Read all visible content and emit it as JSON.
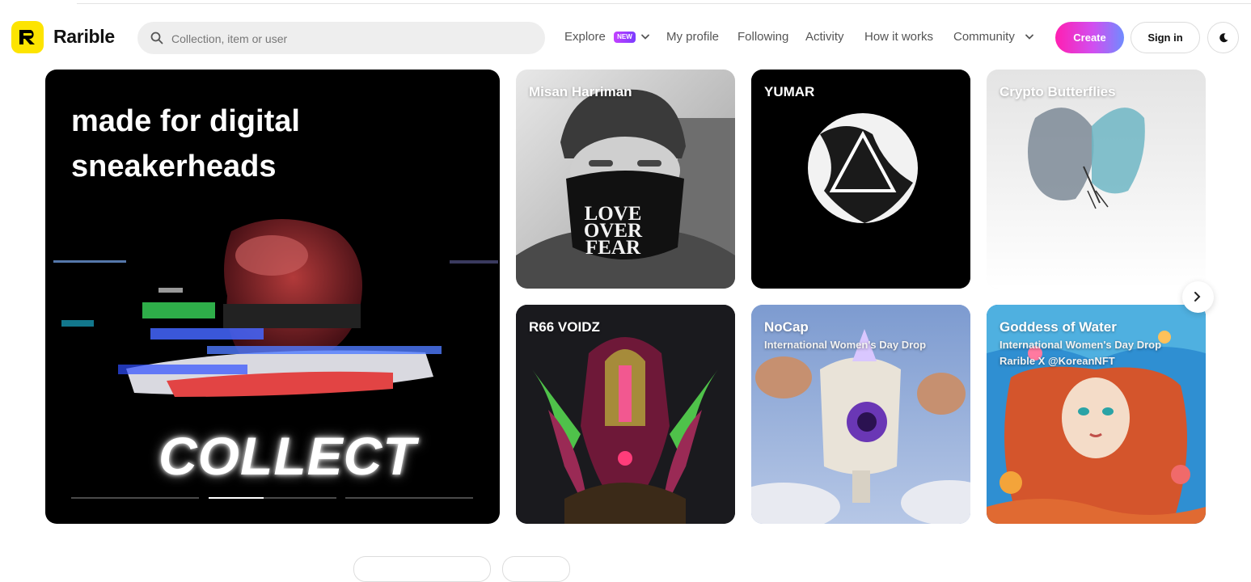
{
  "brand": {
    "name": "Rarible",
    "logo_icon": "rarible-r-logo",
    "accent": "#fde400"
  },
  "search": {
    "placeholder": "Collection, item or user"
  },
  "nav": {
    "explore": "Explore",
    "explore_badge": "NEW",
    "my_profile": "My profile",
    "following": "Following",
    "activity": "Activity",
    "how_it_works": "How it works",
    "community": "Community"
  },
  "actions": {
    "create": "Create",
    "sign_in": "Sign in",
    "theme_icon": "moon-icon"
  },
  "hero": {
    "title": "made for digital sneakerheads",
    "art_text": "COLLECT",
    "progress": [
      0,
      0.43,
      0
    ]
  },
  "tiles": [
    {
      "title": "Misan Harriman",
      "subtitle": "",
      "subtitle2": "",
      "mask_text": [
        "LOVE",
        "OVER",
        "FEAR"
      ]
    },
    {
      "title": "YUMAR",
      "subtitle": "",
      "subtitle2": ""
    },
    {
      "title": "Crypto Butterflies",
      "subtitle": "",
      "subtitle2": ""
    },
    {
      "title": "R66 VOIDZ",
      "subtitle": "",
      "subtitle2": ""
    },
    {
      "title": "NoCap",
      "subtitle": "International Women's Day Drop",
      "subtitle2": ""
    },
    {
      "title": "Goddess of Water",
      "subtitle": "International Women's Day Drop",
      "subtitle2": "Rarible X @KoreanNFT"
    }
  ],
  "carousel": {
    "next_icon": "chevron-right-icon"
  },
  "colors": {
    "create_gradient": [
      "#ff1fb1",
      "#6f8cff"
    ],
    "badge": "#a83cff"
  }
}
